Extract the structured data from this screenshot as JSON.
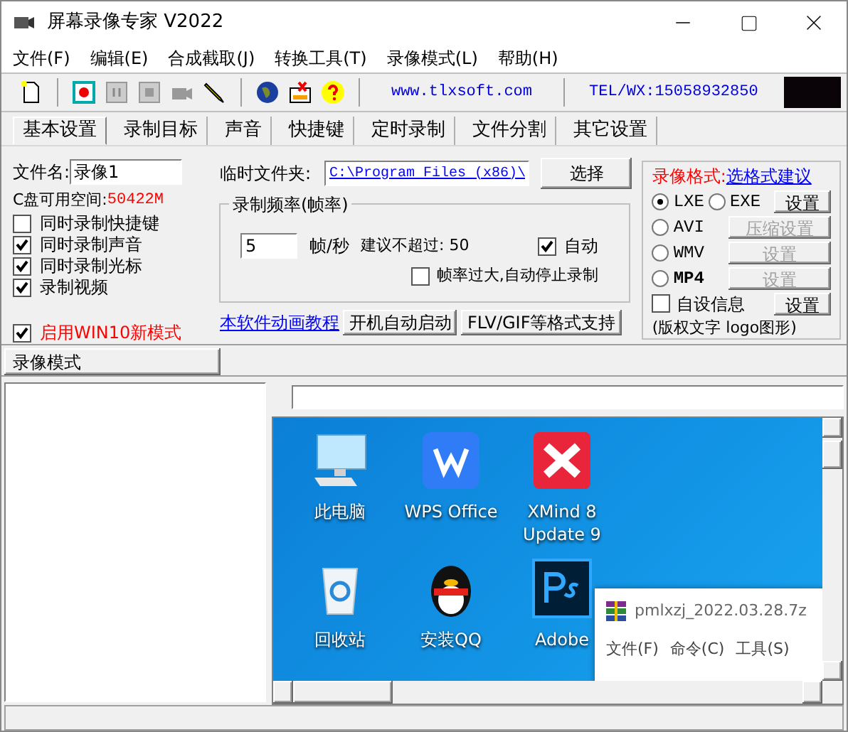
{
  "window": {
    "title": "屏幕录像专家 V2022"
  },
  "menu": [
    "文件(F)",
    "编辑(E)",
    "合成截取(J)",
    "转换工具(T)",
    "录像模式(L)",
    "帮助(H)"
  ],
  "toolbar": {
    "website": "www.tlxsoft.com",
    "contact": "TEL/WX:15058932850"
  },
  "tabs": [
    {
      "label": "基本设置",
      "selected": true
    },
    {
      "label": "录制目标",
      "selected": false
    },
    {
      "label": "声音",
      "selected": false
    },
    {
      "label": "快捷键",
      "selected": false
    },
    {
      "label": "定时录制",
      "selected": false
    },
    {
      "label": "文件分割",
      "selected": false
    },
    {
      "label": "其它设置",
      "selected": false
    }
  ],
  "basic": {
    "filename_label": "文件名:",
    "filename": "录像1",
    "disk_label": "C盘可用空间:",
    "disk_free": "50422M",
    "options": [
      {
        "label": "同时录制快捷键",
        "checked": false
      },
      {
        "label": "同时录制声音",
        "checked": true
      },
      {
        "label": "同时录制光标",
        "checked": true
      },
      {
        "label": "录制视频",
        "checked": true
      }
    ],
    "win10": {
      "label": "启用WIN10新模式",
      "checked": true
    },
    "temp_folder_label": "临时文件夹:",
    "temp_folder": "C:\\Program Files (x86)\\",
    "choose_button": "选择",
    "frame_rate": {
      "title": "录制频率(帧率)",
      "value": "5",
      "unit": "帧/秒",
      "hint": "建议不超过: 50",
      "auto": {
        "label": "自动",
        "checked": true
      },
      "auto_stop": {
        "label": "帧率过大,自动停止录制",
        "checked": false
      }
    },
    "tutorial_link": "本软件动画教程",
    "buttons": [
      "开机自动启动",
      "FLV/GIF等格式支持"
    ],
    "format": {
      "title": "录像格式:",
      "suggest_link": "选格式建议",
      "formats": [
        {
          "label": "LXE",
          "selected": true
        },
        {
          "label": "EXE",
          "selected": false
        },
        {
          "label": "AVI",
          "selected": false
        },
        {
          "label": "WMV",
          "selected": false
        },
        {
          "label": "MP4",
          "selected": false
        }
      ],
      "buttons": [
        {
          "label": "设置",
          "disabled": false
        },
        {
          "label": "压缩设置",
          "disabled": true
        },
        {
          "label": "设置",
          "disabled": true
        },
        {
          "label": "设置",
          "disabled": true
        }
      ],
      "custom_info": {
        "label": "自设信息",
        "checked": false,
        "button": "设置",
        "note": "(版权文字 logo图形)"
      }
    }
  },
  "mode_tab": "录像模式",
  "preview": {
    "icons": [
      {
        "kind": "computer",
        "label": "此电脑"
      },
      {
        "kind": "wps",
        "label": "WPS Office"
      },
      {
        "kind": "xmind",
        "label": "XMind 8 Update 9"
      },
      {
        "kind": "recycle",
        "label": "回收站"
      },
      {
        "kind": "qq",
        "label": "安装QQ"
      },
      {
        "kind": "ps",
        "label": "Adobe"
      }
    ],
    "popup": {
      "title": "pmlxzj_2022.03.28.7z",
      "menu": [
        "文件(F)",
        "命令(C)",
        "工具(S)"
      ]
    }
  }
}
